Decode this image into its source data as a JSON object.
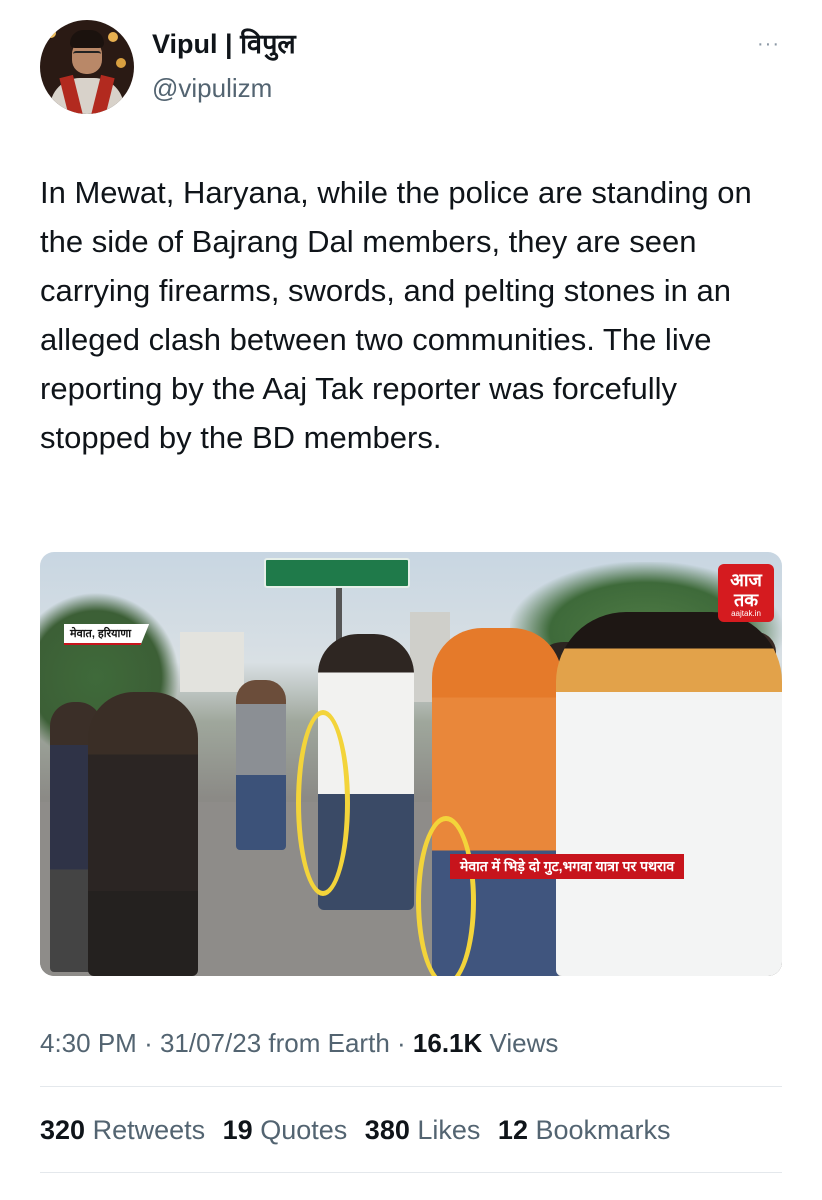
{
  "author": {
    "name": "Vipul | विपुल",
    "handle": "@vipulizm",
    "more_icon": "···"
  },
  "tweet": {
    "text": "In Mewat, Haryana, while the police are standing on the side of Bajrang Dal members, they are seen carrying firearms, swords, and pelting stones in an alleged clash between two communities. The live reporting by the Aaj Tak reporter was forcefully stopped by the BD members."
  },
  "media": {
    "location_tag": "मेवात, हरियाणा",
    "channel_logo": "आज तक",
    "channel_url": "aajtak.in",
    "ticker": "मेवात में भिड़े दो गुट,भगवा यात्रा पर पथराव",
    "highlight_color": "#f3d43a"
  },
  "meta": {
    "time": "4:30 PM",
    "date": "31/07/23",
    "source": "from Earth",
    "views_count": "16.1K",
    "views_label": "Views"
  },
  "stats": {
    "retweets_count": "320",
    "retweets_label": "Retweets",
    "quotes_count": "19",
    "quotes_label": "Quotes",
    "likes_count": "380",
    "likes_label": "Likes",
    "bookmarks_count": "12",
    "bookmarks_label": "Bookmarks"
  }
}
